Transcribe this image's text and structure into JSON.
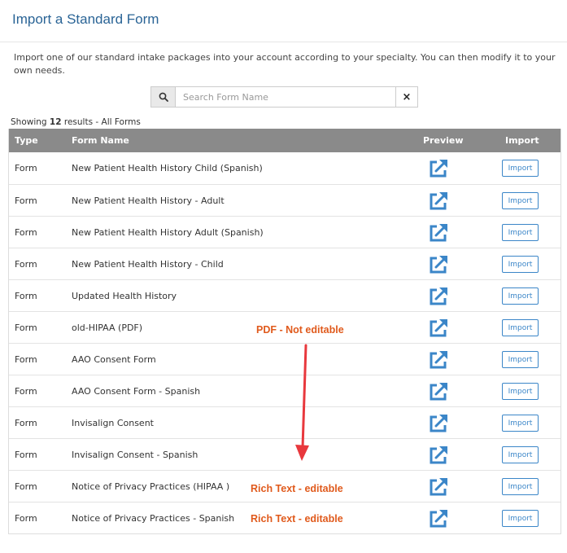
{
  "header": {
    "title": "Import a Standard Form"
  },
  "intro": {
    "text": "Import one of our standard intake packages into your account according to your specialty. You can then modify it to your own needs."
  },
  "search": {
    "placeholder": "Search Form Name",
    "value": "",
    "clear_label": "×"
  },
  "results": {
    "prefix": "Showing ",
    "count": "12",
    "suffix": " results - All Forms"
  },
  "table": {
    "headers": {
      "type": "Type",
      "name": "Form Name",
      "preview": "Preview",
      "import": "Import"
    },
    "rows": [
      {
        "type": "Form",
        "name": "New Patient Health History Child (Spanish)",
        "import_label": "Import"
      },
      {
        "type": "Form",
        "name": "New Patient Health History - Adult",
        "import_label": "Import"
      },
      {
        "type": "Form",
        "name": "New Patient Health History Adult (Spanish)",
        "import_label": "Import"
      },
      {
        "type": "Form",
        "name": "New Patient Health History - Child",
        "import_label": "Import"
      },
      {
        "type": "Form",
        "name": "Updated Health History",
        "import_label": "Import"
      },
      {
        "type": "Form",
        "name": "old-HIPAA (PDF)",
        "import_label": "Import"
      },
      {
        "type": "Form",
        "name": "AAO Consent Form",
        "import_label": "Import"
      },
      {
        "type": "Form",
        "name": "AAO Consent Form - Spanish",
        "import_label": "Import"
      },
      {
        "type": "Form",
        "name": "Invisalign Consent",
        "import_label": "Import"
      },
      {
        "type": "Form",
        "name": "Invisalign Consent - Spanish",
        "import_label": "Import"
      },
      {
        "type": "Form",
        "name": "Notice of Privacy Practices (HIPAA )",
        "import_label": "Import"
      },
      {
        "type": "Form",
        "name": "Notice of Privacy Practices - Spanish",
        "import_label": "Import"
      }
    ]
  },
  "annotations": {
    "pdf_note": "PDF - Not editable",
    "rich_text_1": "Rich Text - editable",
    "rich_text_2": "Rich Text - editable"
  },
  "colors": {
    "title": "#2a6496",
    "accent": "#3b86c8",
    "header_bg": "#8a8a8a",
    "annotation": "#e05a1c",
    "arrow": "#e8383d"
  },
  "icons": {
    "search": "search-icon",
    "preview": "external-link-icon",
    "clear": "close-icon"
  }
}
